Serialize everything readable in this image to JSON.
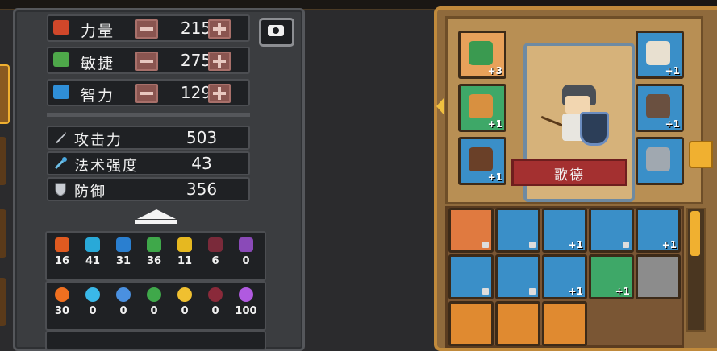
{
  "attributes": [
    {
      "label": "力量",
      "value": "215",
      "icon": "strength-fist-icon",
      "color": "#d0472a"
    },
    {
      "label": "敏捷",
      "value": "275",
      "icon": "agility-feather-icon",
      "color": "#4ea84a"
    },
    {
      "label": "智力",
      "value": "129",
      "icon": "intelligence-book-icon",
      "color": "#2f8fd8"
    }
  ],
  "stats": [
    {
      "label": "攻击力",
      "value": "503",
      "icon": "sword-icon"
    },
    {
      "label": "法术强度",
      "value": "43",
      "icon": "magic-wand-icon"
    },
    {
      "label": "防御",
      "value": "356",
      "icon": "shield-icon"
    }
  ],
  "resistances_shield": [
    {
      "icon": "fire-shield-icon",
      "color": "#e05a20",
      "value": "16"
    },
    {
      "icon": "ice-shield-icon",
      "color": "#29a9d8",
      "value": "41"
    },
    {
      "icon": "lightning-shield-icon",
      "color": "#2a7fd0",
      "value": "31"
    },
    {
      "icon": "poison-shield-icon",
      "color": "#3fa84a",
      "value": "36"
    },
    {
      "icon": "light-shield-icon",
      "color": "#e6b820",
      "value": "11"
    },
    {
      "icon": "dark-shield-icon",
      "color": "#7a2a3a",
      "value": "6"
    },
    {
      "icon": "arcane-shield-icon",
      "color": "#8a4ab8",
      "value": "0"
    }
  ],
  "resistances_element": [
    {
      "icon": "fire-icon",
      "color": "#f07020",
      "value": "30"
    },
    {
      "icon": "ice-crystal-icon",
      "color": "#3ab8e8",
      "value": "0"
    },
    {
      "icon": "lightning-icon",
      "color": "#4a90e0",
      "value": "0"
    },
    {
      "icon": "poison-skull-icon",
      "color": "#3fa84a",
      "value": "0"
    },
    {
      "icon": "sun-icon",
      "color": "#f0c030",
      "value": "0"
    },
    {
      "icon": "crescent-moon-icon",
      "color": "#8a2a3a",
      "value": "0"
    },
    {
      "icon": "arcane-star-icon",
      "color": "#b05ae0",
      "value": "100"
    }
  ],
  "character": {
    "name": "歌德"
  },
  "equipment_left": [
    {
      "icon": "necklace-icon",
      "bg": "#e8a15a",
      "plus": "+3",
      "color": "#3a9a50"
    },
    {
      "icon": "ring-icon",
      "bg": "#3ea868",
      "plus": "+1",
      "color": "#d89040"
    },
    {
      "icon": "boots-icon",
      "bg": "#3a8fc8",
      "plus": "+1",
      "color": "#6a4028"
    }
  ],
  "equipment_right": [
    {
      "icon": "skull-helmet-icon",
      "bg": "#3a8fc8",
      "plus": "+1",
      "color": "#e8e0d0"
    },
    {
      "icon": "armor-icon",
      "bg": "#3a8fc8",
      "plus": "+1",
      "color": "#6a5040"
    },
    {
      "icon": "sword-weapon-icon",
      "bg": "#3a8fc8",
      "plus": "",
      "color": "#a0a8b0"
    }
  ],
  "inventory": [
    {
      "icon": "chest-armor-icon",
      "bg": "#e07a40",
      "plus": "",
      "locked": true
    },
    {
      "icon": "dagger-icon",
      "bg": "#3a8fc8",
      "plus": "",
      "locked": true
    },
    {
      "icon": "crossbow-icon",
      "bg": "#3a8fc8",
      "plus": "+1",
      "locked": false
    },
    {
      "icon": "spear-icon",
      "bg": "#3a8fc8",
      "plus": "",
      "locked": true
    },
    {
      "icon": "gauntlet-icon",
      "bg": "#3a8fc8",
      "plus": "+1",
      "locked": false
    },
    {
      "icon": "helmet-icon",
      "bg": "#3a8fc8",
      "plus": "",
      "locked": true
    },
    {
      "icon": "leather-boots-icon",
      "bg": "#3a8fc8",
      "plus": "",
      "locked": true
    },
    {
      "icon": "amulet-icon",
      "bg": "#3a8fc8",
      "plus": "+1",
      "locked": false
    },
    {
      "icon": "gold-ring-icon",
      "bg": "#3ea868",
      "plus": "+1",
      "locked": false
    },
    {
      "icon": "empty-slot-icon",
      "bg": "#8c8c8c",
      "plus": "",
      "locked": false
    },
    {
      "icon": "green-potion-icon",
      "bg": "#e08a30",
      "plus": "",
      "locked": false
    },
    {
      "icon": "orange-potion-icon",
      "bg": "#e08a30",
      "plus": "",
      "locked": false
    },
    {
      "icon": "amber-potion-icon",
      "bg": "#e08a30",
      "plus": "",
      "locked": false
    }
  ]
}
